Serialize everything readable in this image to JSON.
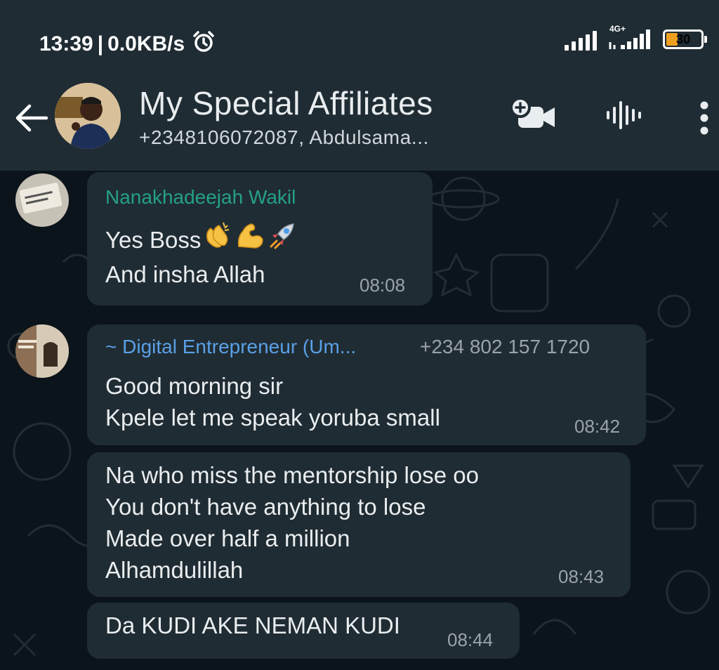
{
  "status_bar": {
    "time": "13:39",
    "separator": "|",
    "speed": "0.0KB/s",
    "network_type": "4G+",
    "battery_level": "30",
    "battery_fraction": 0.3
  },
  "header": {
    "title": "My Special Affiliates",
    "subtitle": "+2348106072087, Abdulsama..."
  },
  "messages": [
    {
      "sender": "Nanakhadeejah Wakil",
      "sender_color": "#24a08a",
      "text": "Yes Boss",
      "emojis": [
        "clapping-hands",
        "flexed-biceps",
        "rocket"
      ],
      "text2": "And insha Allah",
      "time": "08:08"
    },
    {
      "sender": "~ Digital Entrepreneur (Um...",
      "sender_color": "#5aa0e6",
      "phone": "+234 802 157 1720",
      "text": "Good morning sir\nKpele let me speak yoruba small",
      "time": "08:42"
    },
    {
      "text": "Na who miss the mentorship lose oo\nYou don't have anything to lose\nMade over half a million\nAlhamdulillah",
      "time": "08:43"
    },
    {
      "text": "Da KUDI AKE NEMAN KUDI",
      "time": "08:44"
    }
  ],
  "colors": {
    "header_bg": "#1f2c34",
    "chat_bg": "#0b141a",
    "bubble_bg": "#202c33",
    "text": "#e9edef",
    "muted": "#9aa3a8"
  }
}
